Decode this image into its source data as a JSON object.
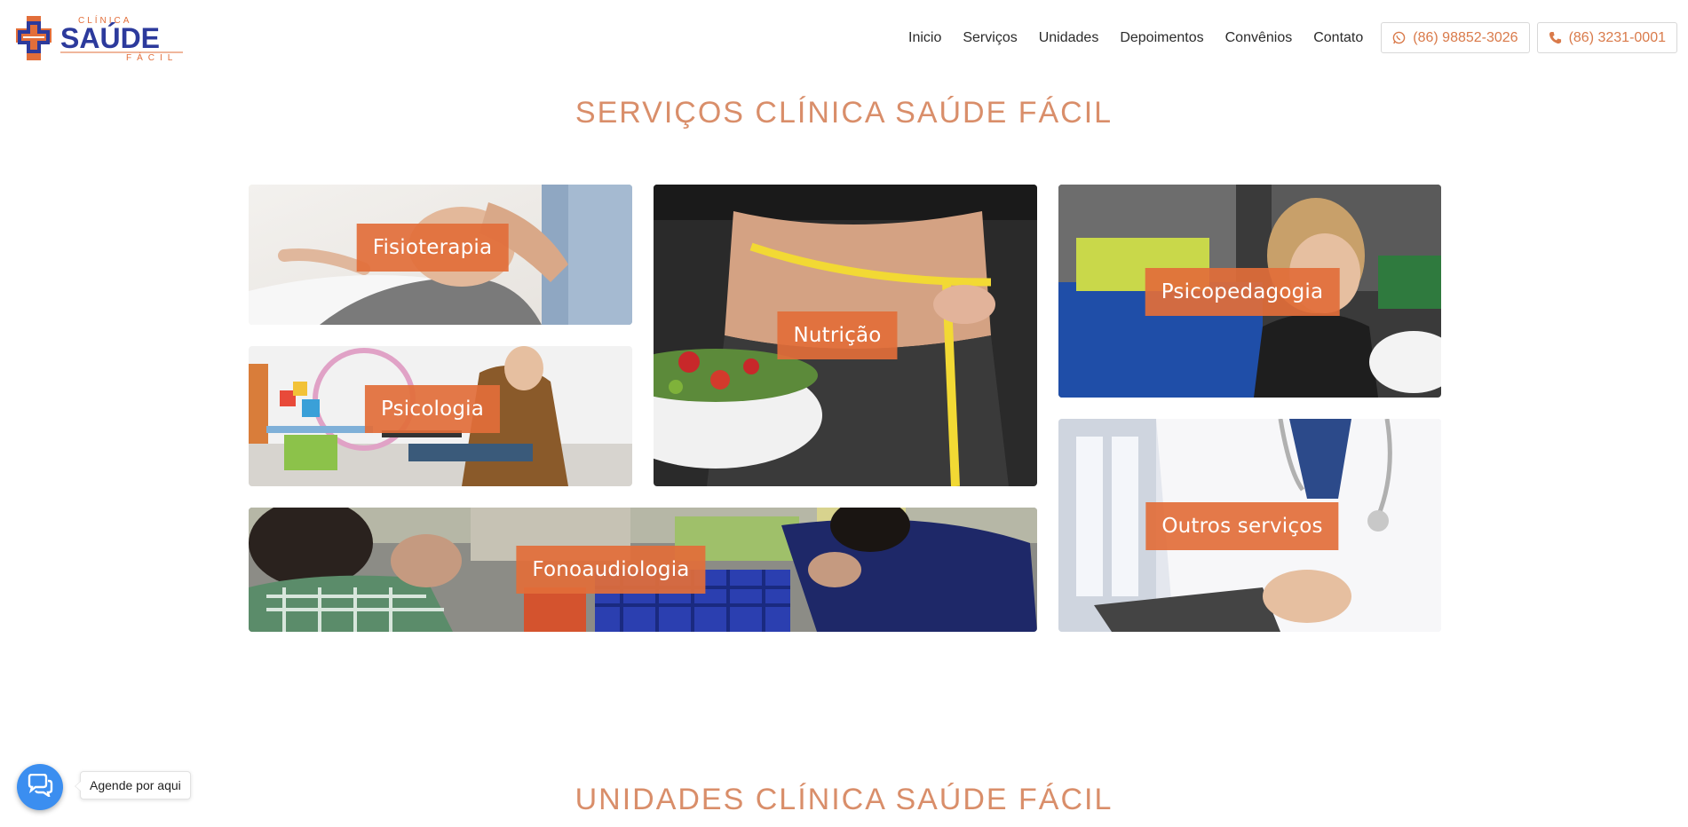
{
  "brand": {
    "logo_top": "CLÍNICA",
    "logo_main": "SAÚDE",
    "logo_bottom": "FÁCIL",
    "primary_color": "#2c3a9c",
    "accent_color": "#e26e3a"
  },
  "nav": {
    "items": [
      "Inicio",
      "Serviços",
      "Unidades",
      "Depoimentos",
      "Convênios",
      "Contato"
    ],
    "whatsapp": {
      "label": "(86) 98852-3026",
      "icon": "whatsapp-icon"
    },
    "phone": {
      "label": "(86) 3231-0001",
      "icon": "phone-icon"
    }
  },
  "services": {
    "title": "SERVIÇOS CLÍNICA SAÚDE FÁCIL",
    "cards": [
      {
        "label": "Fisioterapia"
      },
      {
        "label": "Nutrição"
      },
      {
        "label": "Psicopedagogia"
      },
      {
        "label": "Psicologia"
      },
      {
        "label": "Outros serviços"
      },
      {
        "label": "Fonoaudiologia"
      }
    ]
  },
  "units": {
    "title": "UNIDADES CLÍNICA SAÚDE FÁCIL"
  },
  "chat": {
    "icon": "chat-bubbles-icon",
    "tooltip": "Agende por aqui"
  }
}
